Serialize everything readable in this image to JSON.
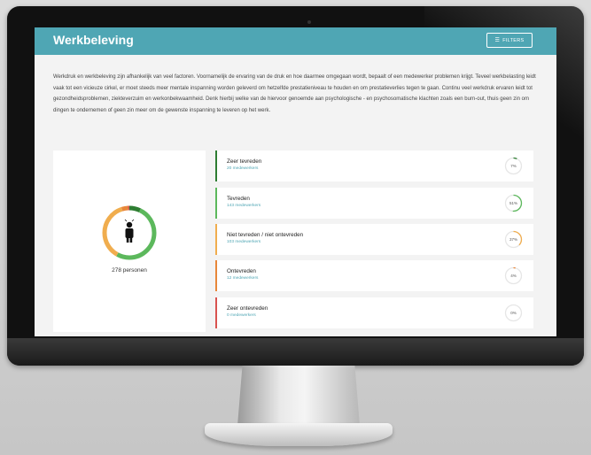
{
  "page": {
    "title": "Werkbeleving",
    "filter_label": "FILTERS",
    "intro": "Werkdruk en werkbeleving zijn afhankelijk van veel factoren. Voornamelijk de ervaring van de druk en hoe daarmee omgegaan wordt, bepaalt of een medewerker problemen krijgt. Teveel werkbelasting leidt vaak tot een vicieuze cirkel, er moet steeds meer mentale inspanning worden geleverd om hetzelfde prestatieniveau te houden en om prestatieverlies tegen te gaan. Continu veel werkdruk ervaren leidt tot gezondheidsproblemen, ziekteverzuim en werkonbekwaamheid. Denk hierbij welke van de hiervoor genoemde aan psychologische - en psychosomatische klachten zoals een burn-out, thuis geen zin om dingen te ondernemen of geen zin meer om de gewenste inspanning te leveren op het werk."
  },
  "summary": {
    "persons": "278 personen",
    "segments": [
      {
        "fraction": 0.07,
        "color": "#2e7d32"
      },
      {
        "fraction": 0.51,
        "color": "#5cb85c"
      },
      {
        "fraction": 0.37,
        "color": "#f0ad4e"
      },
      {
        "fraction": 0.04,
        "color": "#e8873a"
      },
      {
        "fraction": 0.01,
        "color": "#d9534f"
      }
    ]
  },
  "rows": [
    {
      "label": "Zeer tevreden",
      "count": "20 medewerkers",
      "percent": "7%",
      "fraction": 0.07,
      "color": "#2e7d32"
    },
    {
      "label": "Tevreden",
      "count": "143 medewerkers",
      "percent": "51%",
      "fraction": 0.51,
      "color": "#5cb85c"
    },
    {
      "label": "Niet tevreden / niet ontevreden",
      "count": "103 medewerkers",
      "percent": "37%",
      "fraction": 0.37,
      "color": "#f0ad4e"
    },
    {
      "label": "Ontevreden",
      "count": "12 medewerkers",
      "percent": "4%",
      "fraction": 0.04,
      "color": "#e8873a"
    },
    {
      "label": "Zeer ontevreden",
      "count": "0 medewerkers",
      "percent": "0%",
      "fraction": 0.0,
      "color": "#d9534f"
    }
  ]
}
